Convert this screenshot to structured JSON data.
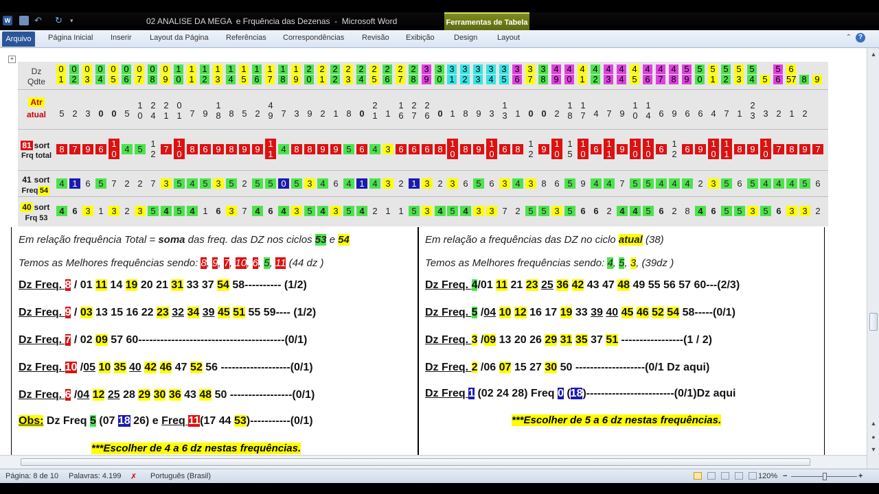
{
  "window": {
    "title": "02 ANALISE DA MEGA  e Frquência das Dezenas  -  Microsoft Word",
    "context_group": "Ferramentas de Tabela"
  },
  "ribbon": {
    "tabs": [
      "Arquivo",
      "Página Inicial",
      "Inserir",
      "Layout da Página",
      "Referências",
      "Correspondências",
      "Revisão",
      "Exibição",
      "Design",
      "Layout"
    ]
  },
  "table": {
    "row_labels": {
      "dz": "Dz",
      "qdte": "Qdte",
      "atr": "Atr",
      "atual": "atual",
      "r81a": "81",
      "r81b": "sort",
      "r81c": "Frq total",
      "r41a": "41",
      "r41b": "sort",
      "r41c": "Freq.",
      "r41d": "54",
      "r40a": "40",
      "r40b": "sort",
      "r40c": "Frq 53"
    },
    "dz_top": [
      "0",
      "0",
      "0",
      "0",
      "0",
      "0",
      "0",
      "0",
      "0",
      "1",
      "1",
      "1",
      "1",
      "1",
      "1",
      "1",
      "1",
      "1",
      "1",
      "2",
      "2",
      "2",
      "2",
      "2",
      "2",
      "2",
      "2",
      "2",
      "3",
      "3",
      "3",
      "3",
      "3",
      "3",
      "3",
      "3",
      "3",
      "3",
      "4",
      "4",
      "4",
      "4",
      "4",
      "4",
      "4",
      "4",
      "4",
      "4",
      "5",
      "5",
      "5",
      "5",
      "5",
      "5",
      "",
      "5",
      "6"
    ],
    "dz_bot": [
      "1",
      "2",
      "3",
      "4",
      "5",
      "6",
      "7",
      "8",
      "9",
      "0",
      "1",
      "2",
      "3",
      "4",
      "5",
      "6",
      "7",
      "8",
      "9",
      "0",
      "1",
      "2",
      "3",
      "4",
      "5",
      "6",
      "7",
      "8",
      "9",
      "0",
      "1",
      "2",
      "3",
      "4",
      "5",
      "6",
      "7",
      "8",
      "9",
      "0",
      "1",
      "2",
      "3",
      "4",
      "5",
      "6",
      "7",
      "8",
      "9",
      "0",
      "1",
      "2",
      "3",
      "4",
      "5",
      "6",
      "57",
      "8",
      "9"
    ],
    "atr": [
      "5",
      "2",
      "3",
      "0",
      "0",
      "5",
      "1 0",
      "2 4",
      "2 1",
      "0 1",
      "7",
      "9",
      "1 8",
      "8",
      "5",
      "2",
      "4 9",
      "7",
      "3",
      "9",
      "2",
      "1",
      "8",
      "0",
      "2 1",
      "1",
      "1 6",
      "2 7",
      "2 6",
      "0",
      "1",
      "8",
      "9",
      "3",
      "1 3",
      "1",
      "0",
      "0",
      "2",
      "1 8",
      "1 7",
      "4",
      "7",
      "9",
      "1 0",
      "1 4",
      "6",
      "9",
      "6",
      "6",
      "4",
      "7",
      "1",
      "2 3",
      "3",
      "2",
      "1",
      "2"
    ],
    "f81": [
      "8",
      "7",
      "9",
      "6",
      "10",
      "4",
      "5",
      "12",
      "7",
      "10",
      "8",
      "6",
      "9",
      "8",
      "9",
      "9",
      "11",
      "4",
      "8",
      "8",
      "9",
      "9",
      "5",
      "6",
      "4",
      "3",
      "6",
      "6",
      "6",
      "8",
      "10",
      "8",
      "9",
      "10",
      "6",
      "8",
      "12",
      "9",
      "10",
      "15",
      "10",
      "6",
      "11",
      "9",
      "10",
      "10",
      "6",
      "12",
      "6",
      "9",
      "10",
      "11",
      "8",
      "9",
      "10",
      "7",
      "8",
      "9",
      "7"
    ],
    "f41": [
      "4",
      "1",
      "6",
      "5",
      "7",
      "2",
      "2",
      "7",
      "3",
      "5",
      "4",
      "5",
      "3",
      "5",
      "2",
      "5",
      "5",
      "0",
      "5",
      "3",
      "4",
      "6",
      "4",
      "1",
      "4",
      "3",
      "2",
      "1",
      "3",
      "2",
      "3",
      "6",
      "5",
      "6",
      "3",
      "4",
      "3",
      "8",
      "6",
      "5",
      "9",
      "4",
      "4",
      "7",
      "5",
      "5",
      "4",
      "4",
      "4",
      "2",
      "3",
      "5",
      "6",
      "5",
      "4",
      "4",
      "4",
      "5",
      "6",
      "4"
    ],
    "f40": [
      "4",
      "6",
      "3",
      "1",
      "3",
      "2",
      "3",
      "5",
      "4",
      "5",
      "4",
      "1",
      "6",
      "3",
      "7",
      "4",
      "6",
      "4",
      "3",
      "5",
      "4",
      "3",
      "5",
      "4",
      "2",
      "1",
      "1",
      "5",
      "3",
      "4",
      "5",
      "4",
      "3",
      "3",
      "7",
      "2",
      "5",
      "5",
      "3",
      "5",
      "6",
      "6",
      "2",
      "4",
      "4",
      "5",
      "6",
      "2",
      "8",
      "4",
      "6",
      "5",
      "5",
      "3",
      "5",
      "6",
      "3",
      "3",
      "2",
      "3"
    ]
  },
  "left": {
    "intro1": "Em relação frequência Total = ",
    "intro_soma": "soma",
    "intro2": " das freq.  das DZ nos ciclos ",
    "c53": "53",
    "e": " e ",
    "c54": "54",
    "best": "Temos as Melhores frequências sendo:",
    "best_vals": [
      "8",
      "9",
      "7",
      "10",
      "6",
      "5",
      "11"
    ],
    "best_tail": "(44 dz )",
    "lines": [
      {
        "pre": "Dz Freq. ",
        "f": "8",
        "rest": " / 01 ",
        "n": [
          [
            "11",
            "y"
          ],
          [
            " 14  ",
            ""
          ],
          [
            "19",
            "y"
          ],
          [
            " 20 21 ",
            ""
          ],
          [
            "31",
            "y"
          ],
          [
            " 33 37 ",
            ""
          ],
          [
            "54",
            "y"
          ],
          [
            " 58---------- (1/2)",
            ""
          ]
        ]
      },
      {
        "pre": "Dz Freq. ",
        "f": "9",
        "rest": " / ",
        "n": [
          [
            "03",
            "y"
          ],
          [
            " 13 15 16 22 ",
            ""
          ],
          [
            "23",
            "y"
          ],
          [
            " ",
            ""
          ],
          [
            "32",
            "u"
          ],
          [
            " ",
            ""
          ],
          [
            "34",
            "y"
          ],
          [
            " ",
            ""
          ],
          [
            "39",
            "u"
          ],
          [
            " ",
            ""
          ],
          [
            "45",
            "y"
          ],
          [
            " ",
            ""
          ],
          [
            "51",
            "y"
          ],
          [
            " 55 59---- (1/2)",
            ""
          ]
        ]
      },
      {
        "pre": "Dz Freq. ",
        "f": "7",
        "rest": " / 02 ",
        "n": [
          [
            "09",
            "y"
          ],
          [
            " 57 60----------------------------------------(0/1)",
            ""
          ]
        ]
      },
      {
        "pre": "Dz Freq. ",
        "f": "10",
        "rest": " /",
        "n": [
          [
            "05",
            "u"
          ],
          [
            " ",
            ""
          ],
          [
            "10",
            "y"
          ],
          [
            " ",
            ""
          ],
          [
            "35",
            "y"
          ],
          [
            " ",
            ""
          ],
          [
            "40",
            "u"
          ],
          [
            " ",
            ""
          ],
          [
            "42",
            "y"
          ],
          [
            " ",
            ""
          ],
          [
            "46",
            "y"
          ],
          [
            " 47 ",
            ""
          ],
          [
            "52",
            "y"
          ],
          [
            " 56  -------------------(0/1)",
            ""
          ]
        ]
      },
      {
        "pre": "Dz Freq. ",
        "f": "6",
        "rest": " /",
        "n": [
          [
            "04",
            "u"
          ],
          [
            " ",
            ""
          ],
          [
            "12",
            "y"
          ],
          [
            " ",
            ""
          ],
          [
            "25",
            "u"
          ],
          [
            " 28 ",
            ""
          ],
          [
            "29",
            "y"
          ],
          [
            " ",
            ""
          ],
          [
            "30",
            "y"
          ],
          [
            " ",
            ""
          ],
          [
            "36",
            "y"
          ],
          [
            " 43 ",
            ""
          ],
          [
            "48",
            "y"
          ],
          [
            " 50  -----------------(0/1)",
            ""
          ]
        ]
      }
    ],
    "obs": {
      "obs": "Obs:",
      "a": " Dz Freq ",
      "f5": "5",
      "b": " (07 ",
      "n18": "18",
      "c": " 26) e ",
      "freq": "Freq ",
      "f11": "11",
      "d": "(17 44 ",
      "n53": "53",
      "e": ")-----------(0/1)"
    },
    "note": "***Escolher de 4 a 6 dz nestas frequências."
  },
  "right": {
    "intro1": "Em relação a  frequências das DZ no ciclo ",
    "atual": "atual",
    "intro2": " (38)",
    "best": "Temos as Melhores frequências sendo:",
    "best_vals": [
      "4",
      "5",
      "3"
    ],
    "best_tail": "(39dz )",
    "lines": [
      {
        "pre": "Dz Freq. ",
        "f": "4",
        "rest": "/01 ",
        "n": [
          [
            "11",
            "y"
          ],
          [
            " 21 ",
            ""
          ],
          [
            "23",
            "y"
          ],
          [
            " ",
            ""
          ],
          [
            "25",
            "u"
          ],
          [
            " ",
            ""
          ],
          [
            "36",
            "y"
          ],
          [
            " ",
            ""
          ],
          [
            "42",
            "y"
          ],
          [
            " 43 47 ",
            ""
          ],
          [
            "48",
            "y"
          ],
          [
            " 49 55 56 57 60---(2/3)",
            ""
          ]
        ]
      },
      {
        "pre": "Dz Freq. ",
        "f": "5",
        "rest": " /",
        "n": [
          [
            "04",
            "u"
          ],
          [
            " ",
            ""
          ],
          [
            "10",
            "y"
          ],
          [
            " ",
            ""
          ],
          [
            "12",
            "y"
          ],
          [
            " 16 17 ",
            ""
          ],
          [
            "19",
            "y"
          ],
          [
            " 33 ",
            ""
          ],
          [
            "39",
            "u"
          ],
          [
            " ",
            ""
          ],
          [
            "40",
            "u"
          ],
          [
            " ",
            ""
          ],
          [
            "45",
            "y"
          ],
          [
            " ",
            ""
          ],
          [
            "46",
            "y"
          ],
          [
            " ",
            ""
          ],
          [
            "52",
            "y"
          ],
          [
            " ",
            ""
          ],
          [
            "54",
            "y"
          ],
          [
            " 58-----(0/1)",
            ""
          ]
        ]
      },
      {
        "pre": "Dz Freq. ",
        "f": "3",
        "rest": " /",
        "n": [
          [
            "09",
            "y"
          ],
          [
            " 13 20  26 ",
            ""
          ],
          [
            "29",
            "y"
          ],
          [
            " ",
            ""
          ],
          [
            "31",
            "y"
          ],
          [
            " ",
            ""
          ],
          [
            "35",
            "y"
          ],
          [
            " 37 ",
            ""
          ],
          [
            "51",
            "y"
          ],
          [
            " -----------------(1 / 2)",
            ""
          ]
        ]
      },
      {
        "pre": "Dz Freq. ",
        "f": "2",
        "rest": " /06 ",
        "n": [
          [
            "07",
            "y"
          ],
          [
            " 15 27 ",
            ""
          ],
          [
            "30",
            "y"
          ],
          [
            " 50  -------------------(0/1 Dz  aqui)",
            ""
          ]
        ]
      }
    ],
    "line5": {
      "a": "Dz Freq ",
      "f1": "1",
      "b": " (02 24 28)  Freq ",
      "f0": "0",
      "c": " (",
      "n18": "18",
      "d": ")------------------------(0/1)Dz aqui"
    },
    "note": "***Escolher de 5 a 6 dz nestas frequências."
  },
  "status": {
    "page": "Página: 8 de 10",
    "words": "Palavras: 4.199",
    "lang": "Português (Brasil)",
    "zoom": "120%"
  }
}
